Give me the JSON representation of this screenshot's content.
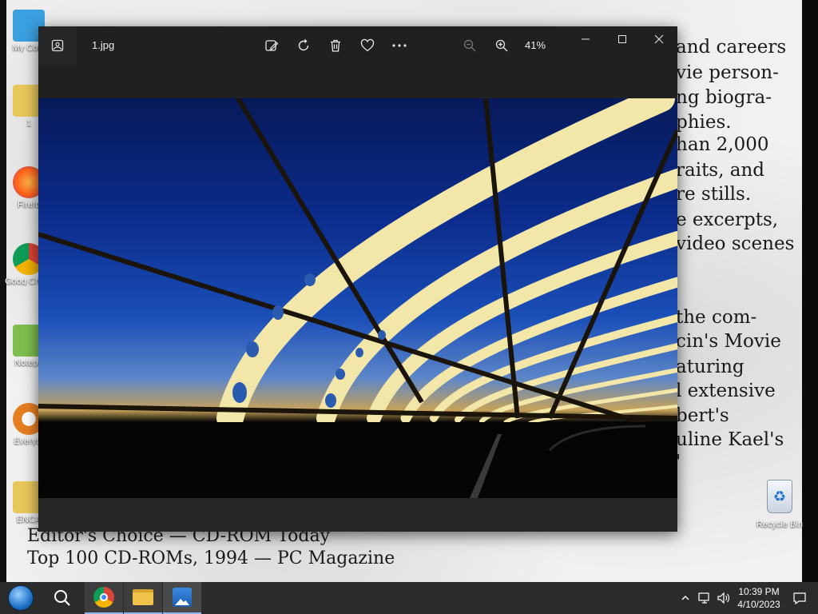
{
  "desktop": {
    "wallpaper_right_lines": [
      "and careers",
      "vie person-",
      "ng biogra-",
      "phies.",
      "han 2,000",
      "raits, and",
      "re stills.",
      "e excerpts,",
      "video scenes",
      "",
      "the com-",
      "cin's Movie",
      "aturing",
      "l extensive",
      "bert's",
      "uline Kael's",
      "'"
    ],
    "wallpaper_bottom_lines": [
      "Editor's Choice — CD-ROM Today",
      "Top 100 CD-ROMs, 1994 — PC Magazine"
    ],
    "icons": [
      {
        "label": "My Com",
        "icon": "computer-icon",
        "color": "#3aa0e0"
      },
      {
        "label": "1",
        "icon": "folder-icon",
        "color": "#e8c85a"
      },
      {
        "label": "Firefo",
        "icon": "firefox-icon",
        "color": "#ff7a1a"
      },
      {
        "label": "Goog Chron",
        "icon": "chrome-icon",
        "color": "#2f9e44"
      },
      {
        "label": "Notepa",
        "icon": "notepad-icon",
        "color": "#7fbf4f"
      },
      {
        "label": "Everyth",
        "icon": "search-icon",
        "color": "#e67e22"
      },
      {
        "label": "ENCA",
        "icon": "folder-icon",
        "color": "#e8c85a"
      }
    ],
    "recycle_bin_label": "Recycle Bin"
  },
  "photos_window": {
    "filename": "1.jpg",
    "zoom_level": "41%",
    "toolbar": {
      "edit_icon": "edit-image-icon",
      "rotate_icon": "rotate-icon",
      "delete_icon": "trash-icon",
      "favorite_icon": "heart-icon",
      "more_icon": "more-icon",
      "zoom_out_icon": "zoom-out-icon",
      "zoom_in_icon": "zoom-in-icon"
    }
  },
  "taskbar": {
    "time": "10:39 PM",
    "date": "4/10/2023",
    "apps": [
      "start",
      "search",
      "chrome",
      "file-explorer",
      "photos"
    ]
  },
  "colors": {
    "window_bg": "#202020",
    "taskbar_bg": "#2b2b2b",
    "sky_top": "#071a5a",
    "structure": "#f2e6a8"
  }
}
